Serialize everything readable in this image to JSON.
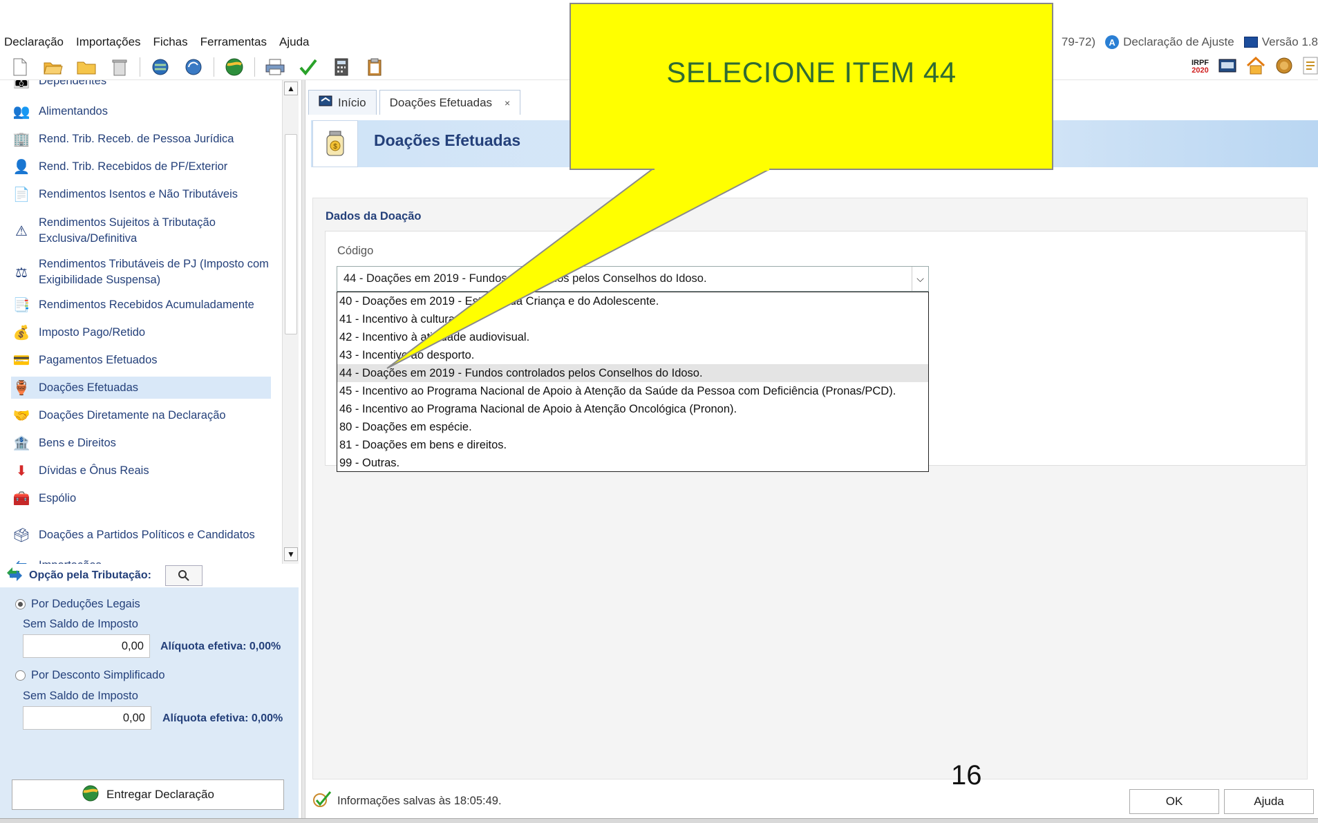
{
  "menu": {
    "items": [
      "Declaração",
      "Importações",
      "Fichas",
      "Ferramentas",
      "Ajuda"
    ],
    "right": {
      "partial_code": "79-72)",
      "declaration_type": "Declaração de Ajuste",
      "version": "Versão 1.8"
    }
  },
  "toolbar": {
    "icons": [
      "new-file-icon",
      "open-folder-icon",
      "folder-icon",
      "trash-icon",
      "globe-icon",
      "globe-refresh-icon",
      "earth-send-icon",
      "print-icon",
      "check-icon",
      "calculator-icon",
      "clipboard-icon"
    ],
    "right_badges": {
      "irpf": "IRPF",
      "irpf_year": "2020"
    }
  },
  "sidebar": {
    "items": [
      {
        "label": "Dependentes",
        "icon": "dependents-icon"
      },
      {
        "label": "Alimentandos",
        "icon": "people-icon"
      },
      {
        "label": "Rend. Trib. Receb. de Pessoa Jurídica",
        "icon": "income-pj-icon"
      },
      {
        "label": "Rend. Trib. Recebidos de PF/Exterior",
        "icon": "income-pf-icon"
      },
      {
        "label": "Rendimentos Isentos e Não Tributáveis",
        "icon": "exempt-document-icon"
      },
      {
        "label": "Rendimentos Sujeitos à Tributação Exclusiva/Definitiva",
        "icon": "warning-document-icon"
      },
      {
        "label": "Rendimentos Tributáveis de PJ (Imposto com Exigibilidade Suspensa)",
        "icon": "suspended-income-icon"
      },
      {
        "label": "Rendimentos Recebidos Acumuladamente",
        "icon": "accumulated-income-icon"
      },
      {
        "label": "Imposto Pago/Retido",
        "icon": "tax-paid-icon"
      },
      {
        "label": "Pagamentos Efetuados",
        "icon": "credit-card-icon"
      },
      {
        "label": "Doações Efetuadas",
        "icon": "donation-jar-icon",
        "selected": true
      },
      {
        "label": "Doações Diretamente na Declaração",
        "icon": "direct-donation-icon"
      },
      {
        "label": "Bens e Direitos",
        "icon": "assets-icon"
      },
      {
        "label": "Dívidas e Ônus Reais",
        "icon": "debt-arrow-icon"
      },
      {
        "label": "Espólio",
        "icon": "chest-icon"
      },
      {
        "label": "Doações a Partidos Políticos e Candidatos",
        "icon": "political-donation-icon"
      },
      {
        "label": "Importações",
        "icon": "import-icon"
      }
    ]
  },
  "tax_option": {
    "title": "Opção pela Tributação:",
    "legal": {
      "label": "Por Deduções Legais",
      "balance_label": "Sem Saldo de Imposto",
      "value": "0,00",
      "rate": "Alíquota efetiva: 0,00%",
      "selected": true
    },
    "simplified": {
      "label": "Por Desconto Simplificado",
      "balance_label": "Sem Saldo de Imposto",
      "value": "0,00",
      "rate": "Alíquota efetiva: 0,00%",
      "selected": false
    },
    "submit_label": "Entregar Declaração"
  },
  "tabs": [
    {
      "label": "Início",
      "active": false
    },
    {
      "label": "Doações Efetuadas",
      "active": true,
      "close": "×"
    }
  ],
  "page": {
    "title": "Doações Efetuadas",
    "section_title": "Dados da Doação",
    "field_label": "Código",
    "selected_value": "44 - Doações em 2019 - Fundos controlados pelos Conselhos do Idoso."
  },
  "dropdown": {
    "options": [
      "40 - Doações em 2019 - Estatuto da Criança e do Adolescente.",
      "41 - Incentivo à cultura.",
      "42 - Incentivo à atividade audiovisual.",
      "43 - Incentivo ao desporto.",
      "44 - Doações em 2019 - Fundos controlados pelos Conselhos do Idoso.",
      "45 - Incentivo ao Programa Nacional de Apoio à Atenção da Saúde da Pessoa com Deficiência (Pronas/PCD).",
      "46 - Incentivo ao Programa Nacional de Apoio à Atenção Oncológica (Pronon).",
      "80 - Doações em espécie.",
      "81 - Doações em bens e direitos.",
      "99 - Outras."
    ],
    "highlighted_index": 4
  },
  "status": {
    "text": "Informações salvas às 18:05:49."
  },
  "buttons": {
    "ok": "OK",
    "help": "Ajuda"
  },
  "callout": {
    "text": "SELECIONE  ITEM 44",
    "color": "#ffff00"
  },
  "slide_number": "16"
}
